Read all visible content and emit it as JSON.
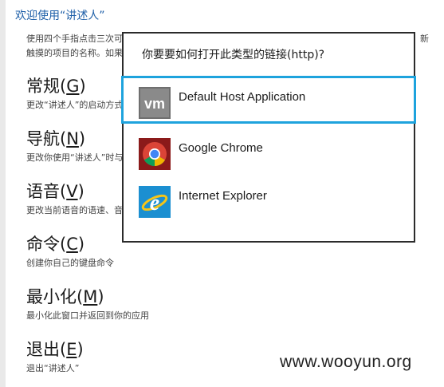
{
  "settings": {
    "title": "欢迎使用“讲述人”",
    "intro_line1": "使用四个手指点击三次可",
    "intro_line1_right": "新",
    "intro_line2": "触摸的项目的名称。如果",
    "sections": [
      {
        "heading": "常规",
        "key": "G",
        "desc": "更改“讲述人”的启动方式"
      },
      {
        "heading": "导航",
        "key": "N",
        "desc": "更改你使用“讲述人”时与"
      },
      {
        "heading": "语音",
        "key": "V",
        "desc": "更改当前语音的语速、音"
      },
      {
        "heading": "命令",
        "key": "C",
        "desc": "创建你自己的键盘命令"
      },
      {
        "heading": "最小化",
        "key": "M",
        "desc": "最小化此窗口并返回到你的应用"
      },
      {
        "heading": "退出",
        "key": "E",
        "desc": "退出“讲述人”"
      }
    ]
  },
  "dialog": {
    "title": "你要要如何打开此类型的链接(http)?",
    "options": [
      {
        "label": "Default Host Application",
        "icon": "vmware-icon",
        "selected": true
      },
      {
        "label": "Google Chrome",
        "icon": "chrome-icon",
        "selected": false
      },
      {
        "label": "Internet Explorer",
        "icon": "ie-icon",
        "selected": false
      }
    ]
  },
  "watermark": "www.wooyun.org",
  "colors": {
    "accent": "#1ea3dd",
    "title": "#1e5fa8"
  }
}
